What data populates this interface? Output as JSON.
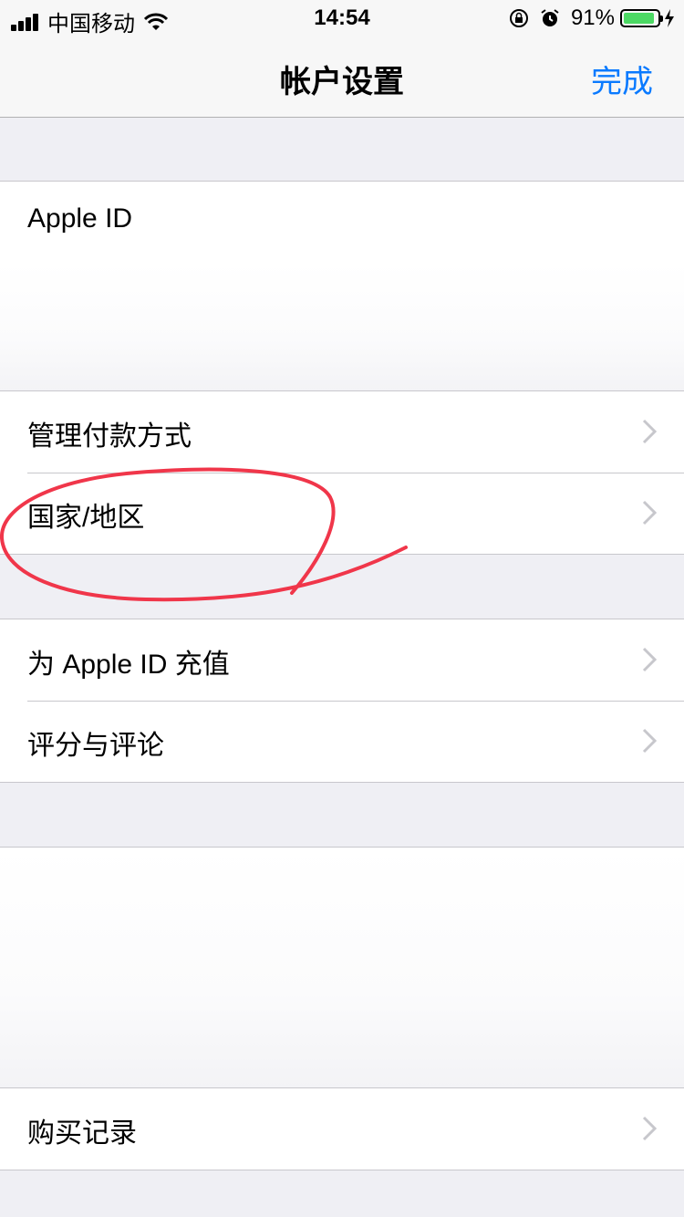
{
  "status_bar": {
    "carrier": "中国移动",
    "time": "14:54",
    "battery_percent": "91%",
    "battery_level": 0.91,
    "icons": [
      "signal-icon",
      "wifi-icon",
      "orientation-lock-icon",
      "alarm-icon",
      "battery-icon",
      "charging-icon"
    ]
  },
  "nav": {
    "title": "帐户设置",
    "done_label": "完成"
  },
  "sections": {
    "apple_id": {
      "label": "Apple ID"
    },
    "payment": {
      "label": "管理付款方式"
    },
    "country": {
      "label": "国家/地区"
    },
    "topup": {
      "label": "为 Apple ID 充值"
    },
    "ratings": {
      "label": "评分与评论"
    },
    "purchases": {
      "label": "购买记录"
    }
  },
  "colors": {
    "accent": "#0a7aff",
    "background": "#efeff4",
    "annotation": "#f0364a",
    "battery": "#4cd964"
  }
}
